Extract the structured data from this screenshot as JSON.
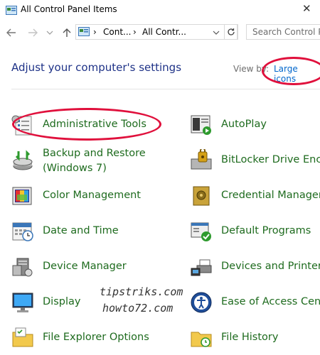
{
  "window": {
    "title": "All Control Panel Items"
  },
  "address_bar": {
    "segments": [
      "Cont...",
      "All Contr..."
    ]
  },
  "search": {
    "placeholder": "Search Control Pa"
  },
  "header": {
    "title": "Adjust your computer's settings",
    "view_by_label": "View by:",
    "view_by_value": "Large icons"
  },
  "items_left": [
    {
      "label": "Administrative Tools",
      "icon": "admin-tools-icon"
    },
    {
      "label_line1": "Backup and Restore",
      "label_line2": "(Windows 7)",
      "icon": "backup-restore-icon"
    },
    {
      "label": "Color Management",
      "icon": "color-management-icon"
    },
    {
      "label": "Date and Time",
      "icon": "date-time-icon"
    },
    {
      "label": "Device Manager",
      "icon": "device-manager-icon"
    },
    {
      "label": "Display",
      "icon": "display-icon"
    },
    {
      "label": "File Explorer Options",
      "icon": "file-explorer-options-icon"
    }
  ],
  "items_right": [
    {
      "label": "AutoPlay",
      "icon": "autoplay-icon"
    },
    {
      "label": "BitLocker Drive Encr",
      "icon": "bitlocker-icon"
    },
    {
      "label": "Credential Manager",
      "icon": "credential-manager-icon"
    },
    {
      "label": "Default Programs",
      "icon": "default-programs-icon"
    },
    {
      "label": "Devices and Printers",
      "icon": "devices-printers-icon"
    },
    {
      "label": "Ease of Access Cente",
      "icon": "ease-of-access-icon"
    },
    {
      "label": "File History",
      "icon": "file-history-icon"
    }
  ],
  "watermark": {
    "line1": "tipstriks.com",
    "line2": "howto72.com"
  },
  "colors": {
    "link_green": "#1e6b1e",
    "heading_blue": "#1e3287",
    "annotation_red": "#e0103c",
    "view_link": "#0066cc"
  }
}
